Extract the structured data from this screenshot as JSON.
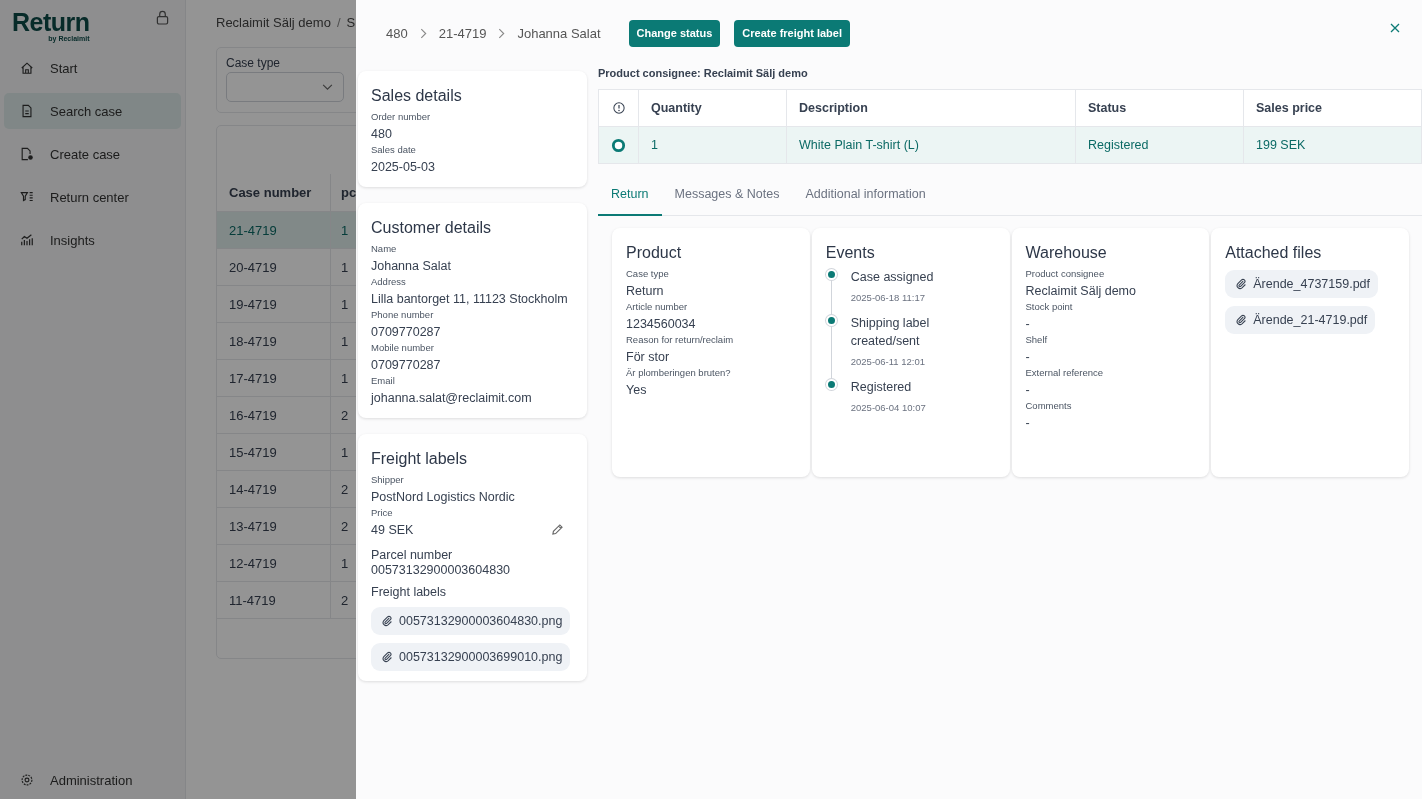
{
  "app": {
    "logo": "Return",
    "logo_sub": "by Reclaimit",
    "nav": [
      {
        "label": "Start",
        "selected": false
      },
      {
        "label": "Search case",
        "selected": true
      },
      {
        "label": "Create case",
        "selected": false
      },
      {
        "label": "Return center",
        "selected": false
      },
      {
        "label": "Insights",
        "selected": false
      }
    ],
    "admin": "Administration",
    "breadcrumb": {
      "parts": [
        "Reclaimit Sälj demo",
        "S"
      ],
      "separator": "/"
    },
    "filter": {
      "label": "Case type"
    },
    "table": {
      "columns": [
        "Case number",
        "pc"
      ],
      "rows": [
        {
          "cells": [
            "21-4719",
            "1"
          ],
          "selected": true
        },
        {
          "cells": [
            "20-4719",
            "1"
          ],
          "selected": false
        },
        {
          "cells": [
            "19-4719",
            "1"
          ],
          "selected": false
        },
        {
          "cells": [
            "18-4719",
            "1"
          ],
          "selected": false
        },
        {
          "cells": [
            "17-4719",
            "1"
          ],
          "selected": false
        },
        {
          "cells": [
            "16-4719",
            "2"
          ],
          "selected": false
        },
        {
          "cells": [
            "15-4719",
            "1"
          ],
          "selected": false
        },
        {
          "cells": [
            "14-4719",
            "2"
          ],
          "selected": false
        },
        {
          "cells": [
            "13-4719",
            "2"
          ],
          "selected": false
        },
        {
          "cells": [
            "12-4719",
            "1"
          ],
          "selected": false
        },
        {
          "cells": [
            "11-4719",
            "2"
          ],
          "selected": false
        }
      ]
    }
  },
  "drawer": {
    "breadcrumb": [
      "480",
      "21-4719",
      "Johanna Salat"
    ],
    "buttons": [
      "Change status",
      "Create freight label"
    ],
    "sales": {
      "title": "Sales details",
      "fields": [
        {
          "label": "Order number",
          "value": "480"
        },
        {
          "label": "Sales date",
          "value": "2025-05-03"
        }
      ]
    },
    "customer": {
      "title": "Customer details",
      "fields": [
        {
          "label": "Name",
          "value": "Johanna Salat"
        },
        {
          "label": "Address",
          "value": "Lilla bantorget 11, 11123 Stockholm"
        },
        {
          "label": "Phone number",
          "value": "0709770287"
        },
        {
          "label": "Mobile number",
          "value": "0709770287"
        },
        {
          "label": "Email",
          "value": "johanna.salat@reclaimit.com"
        }
      ]
    },
    "freight": {
      "title": "Freight labels",
      "fields": [
        {
          "label": "Shipper",
          "value": "PostNord Logistics Nordic"
        },
        {
          "label": "Price",
          "value": "49 SEK"
        }
      ],
      "parcel": {
        "label": "Parcel number",
        "value": "00573132900003604830"
      },
      "files_label": "Freight labels",
      "files": [
        "00573132900003604830.png",
        "00573132900003699010.png"
      ]
    },
    "consignee": "Product consignee: Reclaimit Sälj demo",
    "columns": [
      "Quantity",
      "Description",
      "Status",
      "Sales price"
    ],
    "items": [
      {
        "selected": true,
        "cells": [
          "1",
          "White Plain T-shirt (L)",
          "Registered",
          "199 SEK"
        ]
      }
    ],
    "tabs": [
      {
        "label": "Return",
        "selected": true
      },
      {
        "label": "Messages & Notes",
        "selected": false
      },
      {
        "label": "Additional information",
        "selected": false
      }
    ],
    "product": {
      "title": "Product",
      "fields": [
        {
          "label": "Case type",
          "value": "Return"
        },
        {
          "label": "Article number",
          "value": "1234560034"
        },
        {
          "label": "Reason for return/reclaim",
          "value": "För stor"
        },
        {
          "label": "Är plomberingen bruten?",
          "value": "Yes"
        }
      ]
    },
    "events": {
      "title": "Events",
      "items": [
        {
          "title": "Case assigned",
          "time": "2025-06-18 11:17"
        },
        {
          "title": "Shipping label created/sent",
          "time": "2025-06-11 12:01"
        },
        {
          "title": "Registered",
          "time": "2025-06-04 10:07"
        }
      ]
    },
    "warehouse": {
      "title": "Warehouse",
      "fields": [
        {
          "label": "Product consignee",
          "value": "Reclaimit Sälj demo"
        },
        {
          "label": "Stock point",
          "value": "-"
        },
        {
          "label": "Shelf",
          "value": "-"
        },
        {
          "label": "External reference",
          "value": "-"
        },
        {
          "label": "Comments",
          "value": "-"
        }
      ]
    },
    "attachments": {
      "title": "Attached files",
      "files": [
        "Ärende_4737159.pdf",
        "Ärende_21-4719.pdf"
      ]
    }
  }
}
